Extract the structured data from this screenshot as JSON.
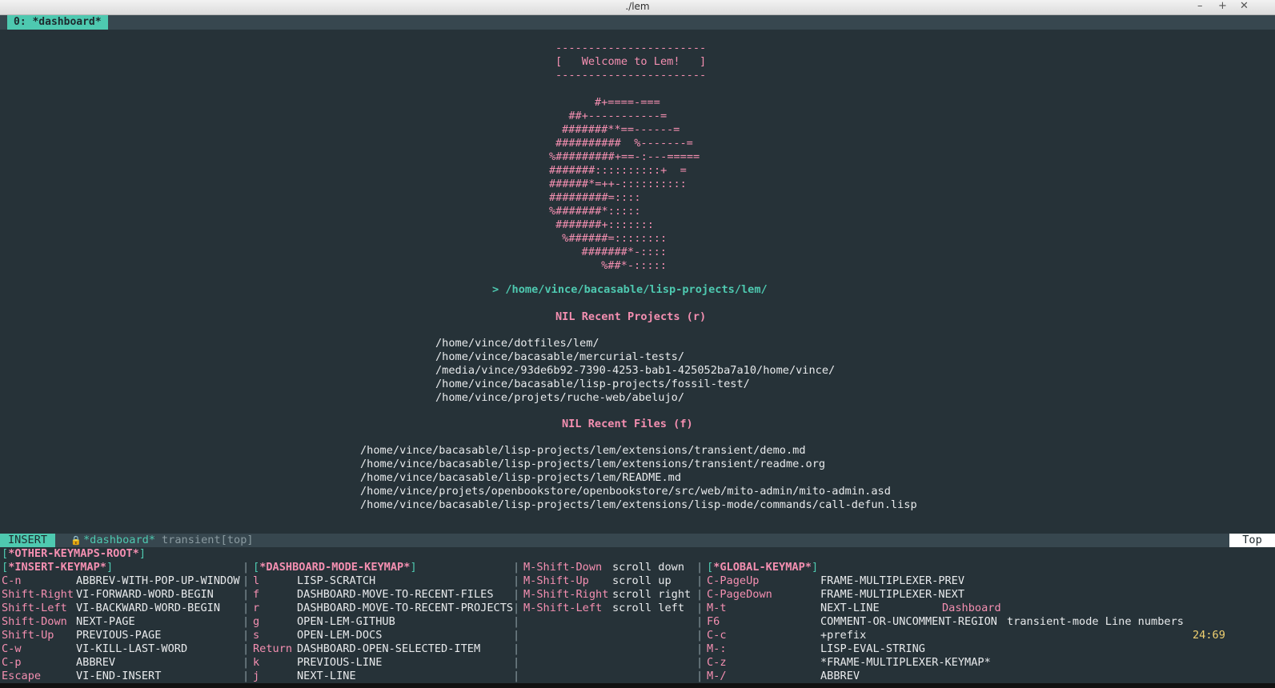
{
  "window": {
    "title": "./lem",
    "minimize": "–",
    "maximize": "+",
    "close": "✕"
  },
  "tab": {
    "label": "0: *dashboard*"
  },
  "dashboard": {
    "banner_top": "-----------------------",
    "banner_text": "[   Welcome to Lem!   ]",
    "banner_bottom": "-----------------------",
    "logo": [
      "     #+====-===",
      "  ##+-----------=",
      "#######**==------=",
      "##########  %-------=",
      "%#########+==-:---=====",
      "#######::::::::::+  =",
      "######*=++-::::::::::",
      "#########=::::",
      "%#######*:::::",
      " #######+:::::::",
      " %######=::::::::",
      "   #######*-::::",
      "      %##*-:::::"
    ],
    "project_path": "> /home/vince/bacasable/lisp-projects/lem/",
    "recent_projects_title": "NIL Recent Projects (r)",
    "recent_projects": [
      "/home/vince/dotfiles/lem/",
      "/home/vince/bacasable/mercurial-tests/",
      "/media/vince/93de6b92-7390-4253-bab1-425052ba7a10/home/vince/",
      "/home/vince/bacasable/lisp-projects/fossil-test/",
      "/home/vince/projets/ruche-web/abelujo/"
    ],
    "recent_files_title": "NIL Recent Files (f)",
    "recent_files": [
      "/home/vince/bacasable/lisp-projects/lem/extensions/transient/demo.md",
      "/home/vince/bacasable/lisp-projects/lem/extensions/transient/readme.org",
      "/home/vince/bacasable/lisp-projects/lem/README.md",
      "/home/vince/projets/openbookstore/openbookstore/src/web/mito-admin/mito-admin.asd",
      "/home/vince/bacasable/lisp-projects/lem/extensions/lisp-mode/commands/call-defun.lisp"
    ]
  },
  "modeline": {
    "state": "INSERT",
    "lock": "🔒",
    "buffer": "*dashboard*",
    "mode": "transient[top]",
    "major_mode": "Dashboard",
    "minor_modes": "transient-mode Line numbers",
    "position": "24:69",
    "scroll": "Top"
  },
  "keymaps": {
    "root": "*OTHER-KEYMAPS-ROOT*",
    "insert": {
      "title": "*INSERT-KEYMAP*",
      "bindings": [
        {
          "key": "C-n",
          "cmd": "ABBREV-WITH-POP-UP-WINDOW"
        },
        {
          "key": "Shift-Right",
          "cmd": "VI-FORWARD-WORD-BEGIN"
        },
        {
          "key": "Shift-Left",
          "cmd": "VI-BACKWARD-WORD-BEGIN"
        },
        {
          "key": "Shift-Down",
          "cmd": "NEXT-PAGE"
        },
        {
          "key": "Shift-Up",
          "cmd": "PREVIOUS-PAGE"
        },
        {
          "key": "C-w",
          "cmd": "VI-KILL-LAST-WORD"
        },
        {
          "key": "C-p",
          "cmd": "ABBREV"
        },
        {
          "key": "Escape",
          "cmd": "VI-END-INSERT"
        }
      ]
    },
    "dashboard": {
      "title": "*DASHBOARD-MODE-KEYMAP*",
      "bindings": [
        {
          "key": "l",
          "cmd": "LISP-SCRATCH"
        },
        {
          "key": "f",
          "cmd": "DASHBOARD-MOVE-TO-RECENT-FILES"
        },
        {
          "key": "r",
          "cmd": "DASHBOARD-MOVE-TO-RECENT-PROJECTS"
        },
        {
          "key": "g",
          "cmd": "OPEN-LEM-GITHUB"
        },
        {
          "key": "s",
          "cmd": "OPEN-LEM-DOCS"
        },
        {
          "key": "Return",
          "cmd": "DASHBOARD-OPEN-SELECTED-ITEM"
        },
        {
          "key": "k",
          "cmd": "PREVIOUS-LINE"
        },
        {
          "key": "j",
          "cmd": "NEXT-LINE"
        }
      ]
    },
    "scroll": {
      "bindings": [
        {
          "key": "M-Shift-Down",
          "cmd": "scroll down"
        },
        {
          "key": "M-Shift-Up",
          "cmd": "scroll up"
        },
        {
          "key": "M-Shift-Right",
          "cmd": "scroll right"
        },
        {
          "key": "M-Shift-Left",
          "cmd": "scroll left"
        }
      ]
    },
    "global": {
      "title": "*GLOBAL-KEYMAP*",
      "bindings": [
        {
          "key": "C-PageUp",
          "cmd": "FRAME-MULTIPLEXER-PREV"
        },
        {
          "key": "C-PageDown",
          "cmd": "FRAME-MULTIPLEXER-NEXT"
        },
        {
          "key": "M-t",
          "cmd": "NEXT-LINE"
        },
        {
          "key": "F6",
          "cmd": "COMMENT-OR-UNCOMMENT-REGION"
        },
        {
          "key": "C-c",
          "cmd": "+prefix"
        },
        {
          "key": "M-:",
          "cmd": "LISP-EVAL-STRING"
        },
        {
          "key": "C-z",
          "cmd": "*FRAME-MULTIPLEXER-KEYMAP*"
        },
        {
          "key": "M-/",
          "cmd": "ABBREV"
        }
      ]
    }
  }
}
